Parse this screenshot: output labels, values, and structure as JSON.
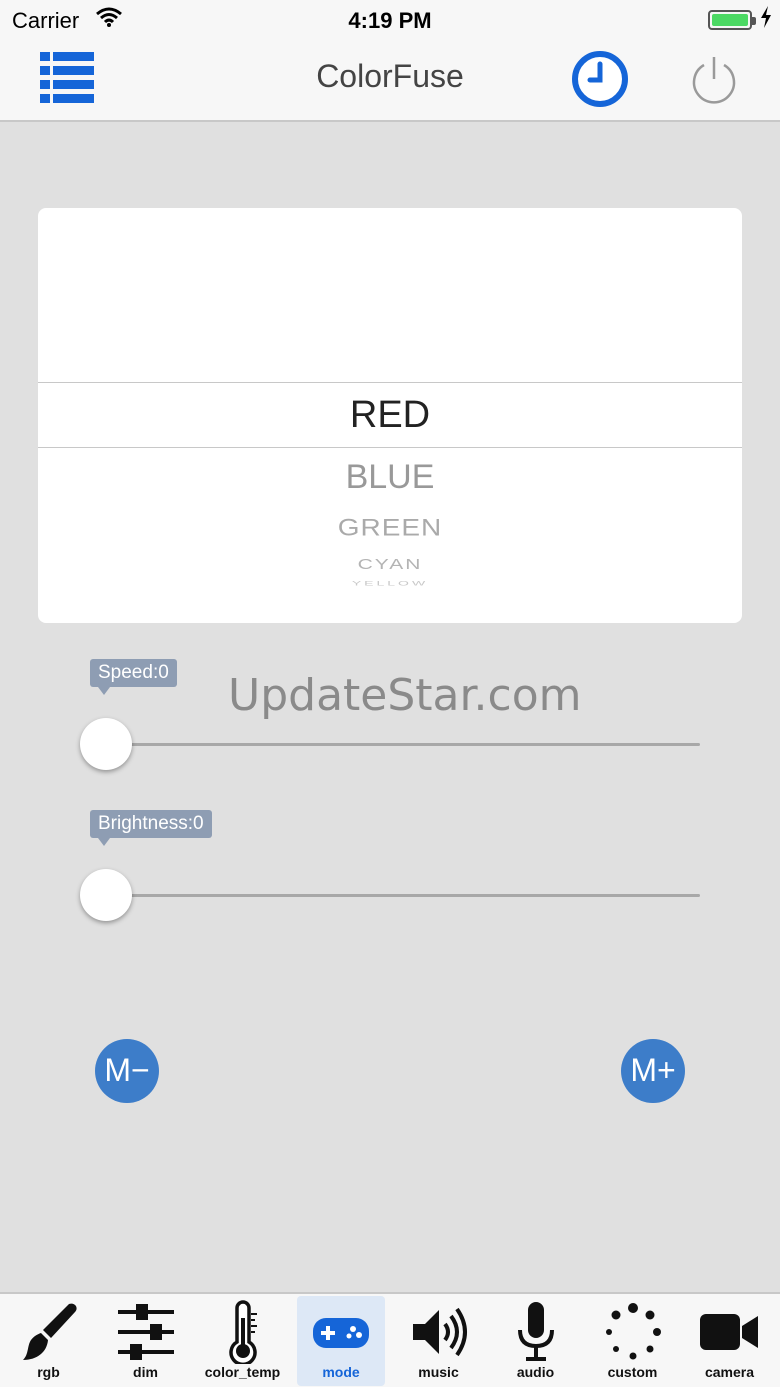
{
  "status_bar": {
    "carrier": "Carrier",
    "time": "4:19 PM"
  },
  "nav": {
    "title": "ColorFuse"
  },
  "picker": {
    "options": [
      "RED",
      "BLUE",
      "GREEN",
      "CYAN",
      "YELLOW"
    ],
    "selected": "RED"
  },
  "watermark": "UpdateStar.com",
  "sliders": {
    "speed": {
      "label": "Speed:0",
      "value": 0
    },
    "brightness": {
      "label": "Brightness:0",
      "value": 0
    }
  },
  "buttons": {
    "m_minus": "M−",
    "m_plus": "M+"
  },
  "tabs": [
    {
      "label": "rgb",
      "icon": "brush-icon"
    },
    {
      "label": "dim",
      "icon": "sliders-icon"
    },
    {
      "label": "color_temp",
      "icon": "thermometer-icon"
    },
    {
      "label": "mode",
      "icon": "gamepad-icon",
      "active": true
    },
    {
      "label": "music",
      "icon": "speaker-icon"
    },
    {
      "label": "audio",
      "icon": "microphone-icon"
    },
    {
      "label": "custom",
      "icon": "dots-circle-icon"
    },
    {
      "label": "camera",
      "icon": "camera-icon"
    }
  ],
  "colors": {
    "accent": "#1565d8",
    "m_button": "#3d7dc9",
    "slider_tip": "#8e9db3"
  }
}
